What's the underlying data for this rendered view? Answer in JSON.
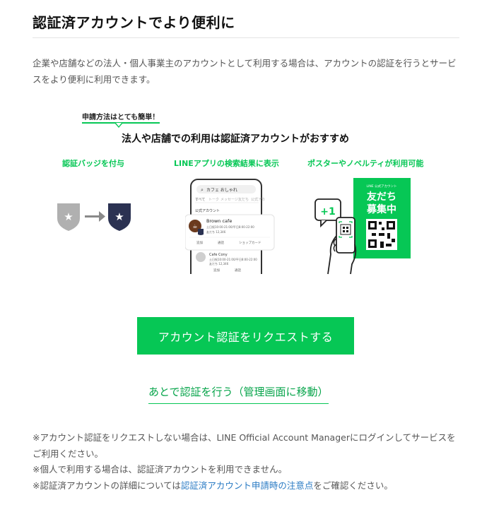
{
  "title": "認証済アカウントでより便利に",
  "description": "企業や店舗などの法人・個人事業主のアカウントとして利用する場合は、アカウントの認証を行うとサービスをより便利に利用できます。",
  "banner": {
    "bubble": "申請方法はとても簡単！",
    "headline": "法人や店舗での利用は認証済アカウントがおすすめ",
    "features": [
      {
        "label": "認証バッジを付与"
      },
      {
        "label": "LINEアプリの検索結果に表示"
      },
      {
        "label": "ポスターやノベルティが利用可能"
      }
    ],
    "phone": {
      "search_text": "カフェ おしゃれ",
      "tabs": [
        "すべて",
        "トーク",
        "メッセージ",
        "友だち",
        "公式アカ"
      ],
      "section": "公式アカウント",
      "card1_name": "Brown cafe",
      "card1_line1": "土日祝10:00-21:00/平日8:00-22:00",
      "card1_line2": "友だち 12,346",
      "card1_actions": [
        "追加",
        "通話",
        "ショップカード"
      ],
      "card2_name": "Cafe Cony",
      "card2_line1": "土日祝10:00-21:00/平日8:00-22:00",
      "card2_line2": "友だち 12,346",
      "card2_actions": [
        "追加",
        "通話"
      ]
    },
    "plus_one": "+1",
    "poster": {
      "small": "LINE 公式アカウント",
      "line1": "友だち",
      "line2": "募集中"
    },
    "colors": {
      "green": "#06c755",
      "navy": "#2b3252",
      "gray": "#b0b0b0"
    }
  },
  "primary_button": "アカウント認証をリクエストする",
  "secondary_link": "あとで認証を行う（管理画面に移動）",
  "notes": {
    "note1": "※アカウント認証をリクエストしない場合は、LINE Official Account Managerにログインしてサービスをご利用ください。",
    "note2": "※個人で利用する場合は、認証済アカウントを利用できません。",
    "note3_prefix": "※認証済アカウントの詳細については",
    "note3_link": "認証済アカウント申請時の注意点",
    "note3_suffix": "をご確認ください。"
  }
}
